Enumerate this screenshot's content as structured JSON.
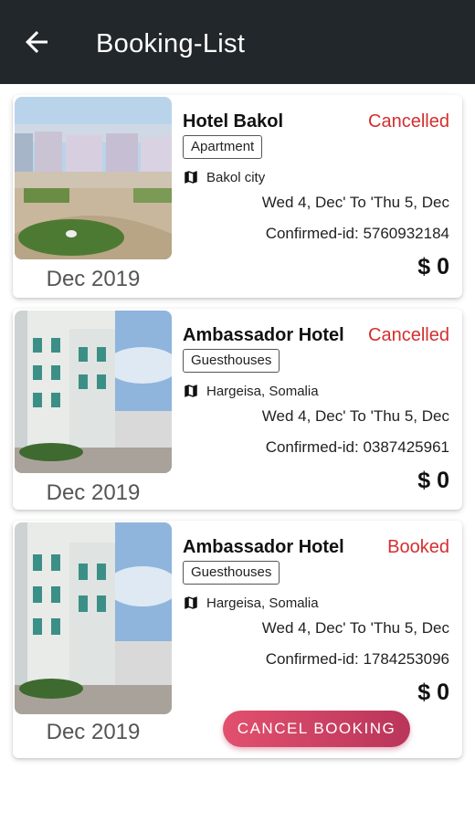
{
  "header": {
    "title": "Booking-List",
    "back_icon": "arrow-left-icon"
  },
  "bookings": [
    {
      "hotel_name": "Hotel Bakol",
      "status": "Cancelled",
      "category": "Apartment",
      "location": "Bakol city",
      "dates": "Wed 4, Dec' To 'Thu 5, Dec",
      "confirmed_id": "Confirmed-id: 5760932184",
      "price": "$ 0",
      "month": "Dec 2019"
    },
    {
      "hotel_name": "Ambassador Hotel",
      "status": "Cancelled",
      "category": "Guesthouses",
      "location": "Hargeisa, Somalia",
      "dates": "Wed 4, Dec' To 'Thu 5, Dec",
      "confirmed_id": "Confirmed-id: 0387425961",
      "price": "$ 0",
      "month": "Dec 2019"
    },
    {
      "hotel_name": "Ambassador Hotel",
      "status": "Booked",
      "category": "Guesthouses",
      "location": "Hargeisa, Somalia",
      "dates": "Wed 4, Dec' To 'Thu 5, Dec",
      "confirmed_id": "Confirmed-id: 1784253096",
      "price": "$ 0",
      "month": "Dec 2019",
      "action_label": "CANCEL BOOKING"
    }
  ],
  "colors": {
    "appbar": "#22272b",
    "status_red": "#d32f2f",
    "button_start": "#e2506e",
    "button_end": "#b9355a"
  }
}
